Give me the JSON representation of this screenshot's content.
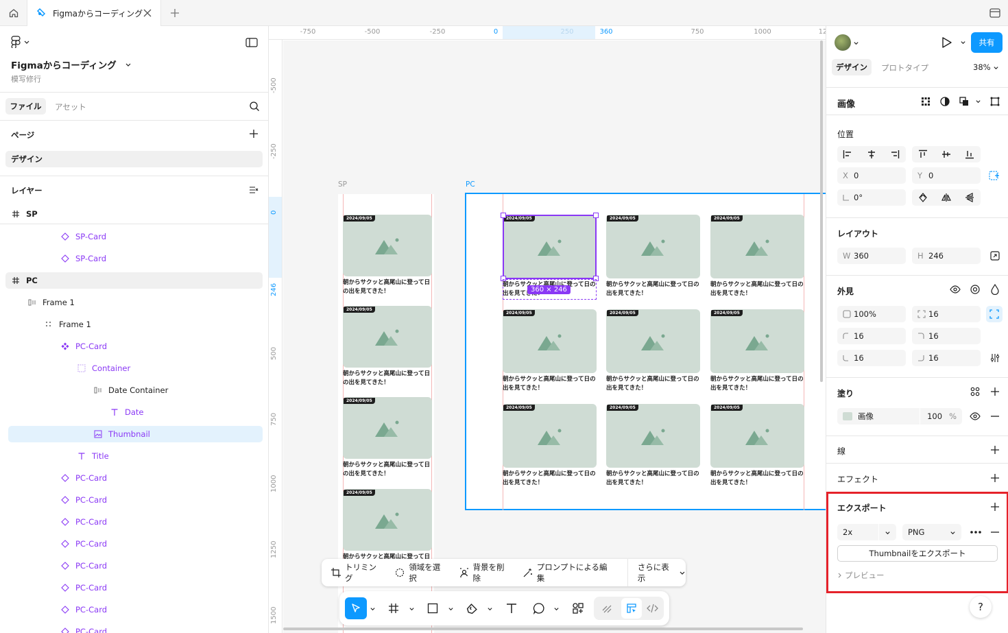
{
  "tabbar": {
    "file_tab": "Figmaからコーディング"
  },
  "left_panel": {
    "file_title": "Figmaからコーディング",
    "subtitle": "模写修行",
    "tabs": {
      "files": "ファイル",
      "assets": "アセット"
    },
    "pages_label": "ページ",
    "current_page": "デザイン",
    "layers_label": "レイヤー",
    "layers": [
      {
        "label": "SP",
        "type": "frame"
      },
      {
        "label": "SP-Card",
        "type": "instance"
      },
      {
        "label": "SP-Card",
        "type": "instance"
      },
      {
        "label": "PC",
        "type": "frame"
      },
      {
        "label": "Frame 1",
        "type": "autolayout-h"
      },
      {
        "label": "Frame 1",
        "type": "autolayout-grid"
      },
      {
        "label": "PC-Card",
        "type": "component"
      },
      {
        "label": "Container",
        "type": "container"
      },
      {
        "label": "Date Container",
        "type": "autolayout-h"
      },
      {
        "label": "Date",
        "type": "text"
      },
      {
        "label": "Thumbnail",
        "type": "image"
      },
      {
        "label": "Title",
        "type": "text"
      },
      {
        "label": "PC-Card",
        "type": "instance"
      },
      {
        "label": "PC-Card",
        "type": "instance"
      },
      {
        "label": "PC-Card",
        "type": "instance"
      },
      {
        "label": "PC-Card",
        "type": "instance"
      },
      {
        "label": "PC-Card",
        "type": "instance"
      },
      {
        "label": "PC-Card",
        "type": "instance"
      },
      {
        "label": "PC-Card",
        "type": "instance"
      },
      {
        "label": "PC-Card",
        "type": "instance"
      }
    ]
  },
  "rulers": {
    "top": [
      "-750",
      "-500",
      "-250",
      "0",
      "250",
      "360",
      "750",
      "1000",
      "12"
    ],
    "left": [
      "-500",
      "-250",
      "0",
      "246",
      "500",
      "750",
      "1000",
      "1250",
      "1500"
    ]
  },
  "canvas": {
    "sp_label": "SP",
    "pc_label": "PC",
    "card_date": "2024/09/05",
    "card_title_line1": "朝からサクッと高尾山に登って日の",
    "card_title_line2": "出を見てきた！",
    "sp_title_line1": "朝からサクッと高尾山に登って日",
    "sp_title_line2": "の出を見てきた！",
    "selection_size": "360 × 246"
  },
  "context_toolbar": {
    "crop": "トリミング",
    "select_area": "領域を選択",
    "remove_bg": "背景を削除",
    "prompt_edit": "プロンプトによる編集",
    "more": "さらに表示"
  },
  "right_panel": {
    "share": "共有",
    "tabs": {
      "design": "デザイン",
      "prototype": "プロトタイプ"
    },
    "zoom": "38%",
    "section_title": "画像",
    "position": {
      "title": "位置",
      "x_label": "X",
      "x": "0",
      "y_label": "Y",
      "y": "0",
      "rotation": "0°"
    },
    "layout": {
      "title": "レイアウト",
      "w_label": "W",
      "w": "360",
      "h_label": "H",
      "h": "246"
    },
    "appearance": {
      "title": "外見",
      "opacity": "100%",
      "radius": "16",
      "r_tl": "16",
      "r_tr": "16",
      "r_bl": "16",
      "r_br": "16"
    },
    "fill": {
      "title": "塗り",
      "type": "画像",
      "opacity": "100",
      "unit": "%"
    },
    "stroke_title": "線",
    "effects_title": "エフェクト",
    "export": {
      "title": "エクスポート",
      "scale": "2x",
      "format": "PNG",
      "button": "Thumbnailをエクスポート",
      "preview": "プレビュー"
    },
    "help": "?"
  },
  "colors": {
    "accent": "#0d99ff",
    "highlight": "#e5222a",
    "selection": "#8a38f5",
    "thumbnail_bg": "#cfdcd4",
    "mountain": "#7aa890"
  }
}
